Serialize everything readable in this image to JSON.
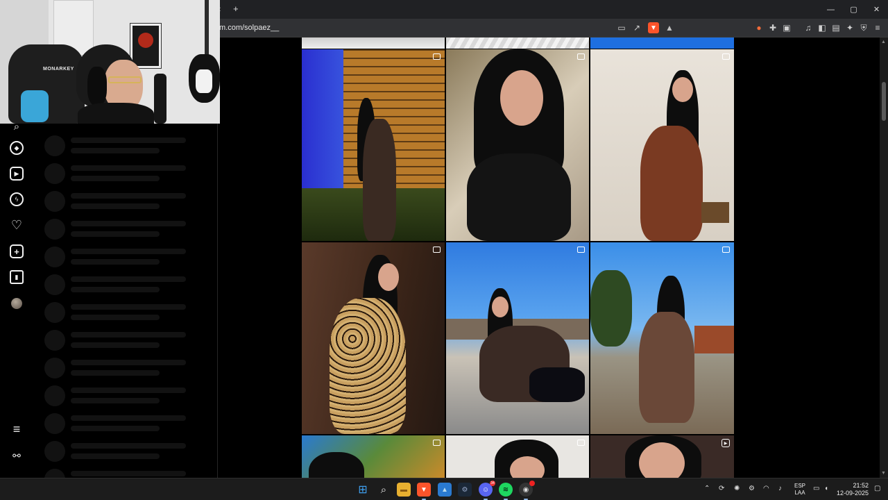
{
  "browser": {
    "tab_back_symbol": "‹",
    "new_tab_symbol": "+",
    "url": "m.com/solpaez__",
    "window_controls": {
      "minimize": "—",
      "maximize": "▢",
      "close": "✕"
    },
    "toolbar_icons": [
      "cast-icon",
      "share-icon",
      "brave-shields-icon",
      "brave-rewards-icon",
      "flame-icon",
      "extensions-icon",
      "screenshot-icon",
      "music-icon",
      "sidebar-icon",
      "wallet-icon",
      "leo-ai-icon",
      "vpn-icon",
      "menu-icon"
    ],
    "brave_color": "#fb542b"
  },
  "webcam": {
    "chair_brand": "MONARKEY",
    "accent_color": "#3aa6d8"
  },
  "instagram": {
    "nav_icons": [
      "search-icon",
      "explore-icon",
      "reels-icon",
      "messenger-icon",
      "heart-icon",
      "create-icon",
      "insights-icon",
      "profile-avatar",
      "menu-icon",
      "threads-icon"
    ],
    "notification_placeholders": 13,
    "posts": [
      {
        "row": 1,
        "col": 1,
        "type": "carousel",
        "scene": "brick wall with blue windows"
      },
      {
        "row": 1,
        "col": 2,
        "type": "carousel",
        "scene": "selfie black top"
      },
      {
        "row": 1,
        "col": 3,
        "type": "carousel",
        "scene": "brown leggings standing"
      },
      {
        "row": 2,
        "col": 1,
        "type": "carousel",
        "scene": "leopard print wooden wall"
      },
      {
        "row": 2,
        "col": 2,
        "type": "carousel",
        "scene": "sitting outdoors blue sky"
      },
      {
        "row": 2,
        "col": 3,
        "type": "carousel",
        "scene": "brown flare pants park"
      },
      {
        "row": 3,
        "col": 1,
        "type": "carousel",
        "scene": "trees autumn"
      },
      {
        "row": 3,
        "col": 2,
        "type": "carousel",
        "scene": "bangs portrait"
      },
      {
        "row": 3,
        "col": 3,
        "type": "reel",
        "scene": "close portrait"
      }
    ]
  },
  "taskbar": {
    "apps": [
      "windows-start-icon",
      "search-icon",
      "file-explorer-icon",
      "brave-browser-icon",
      "photos-icon",
      "steam-icon",
      "discord-icon",
      "spotify-icon",
      "obs-icon"
    ],
    "discord_badge": "34",
    "language_line1": "ESP",
    "language_line2": "LAA",
    "time": "21:52",
    "date": "12-09-2025"
  }
}
